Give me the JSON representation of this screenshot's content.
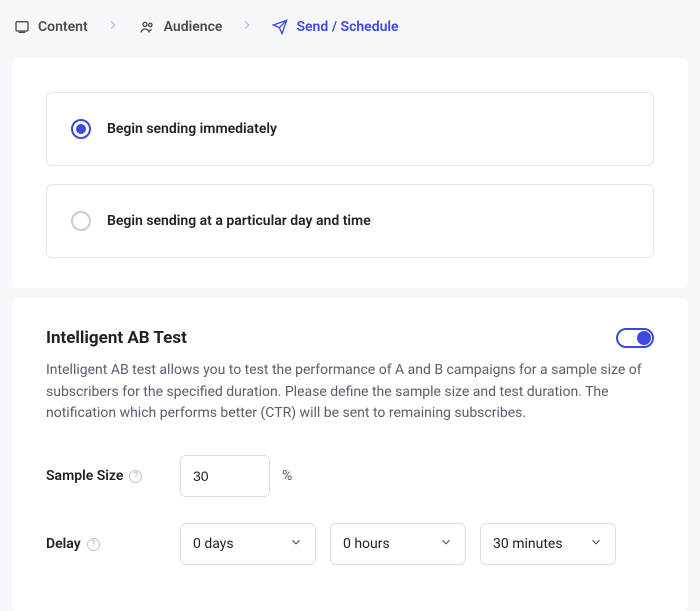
{
  "breadcrumb": {
    "content": "Content",
    "audience": "Audience",
    "send": "Send / Schedule"
  },
  "radios": {
    "immediate": "Begin sending immediately",
    "scheduled": "Begin sending at a particular day and time"
  },
  "ab": {
    "title": "Intelligent AB Test",
    "desc": "Intelligent AB test allows you to test the performance of A and B campaigns for a sample size of subscribers for the specified duration. Please define the sample size and test duration. The notification which performs better (CTR) will be sent to remaining subscribes."
  },
  "sample": {
    "label": "Sample Size",
    "value": "30",
    "unit": "%"
  },
  "delay": {
    "label": "Delay",
    "days": "0 days",
    "hours": "0 hours",
    "minutes": "30 minutes"
  }
}
